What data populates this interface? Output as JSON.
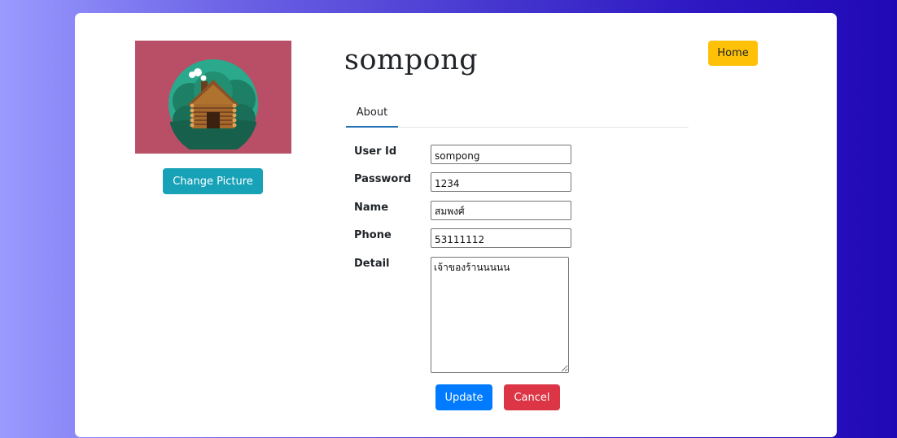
{
  "profile": {
    "username": "sompong",
    "change_picture_label": "Change Picture",
    "avatar_image": "log-cabin-icon"
  },
  "nav": {
    "home_label": "Home"
  },
  "tabs": [
    {
      "label": "About",
      "active": true
    }
  ],
  "form": {
    "fields": [
      {
        "label": "User Id",
        "value": "sompong"
      },
      {
        "label": "Password",
        "value": "1234"
      },
      {
        "label": "Name",
        "value": "สมพงศ์"
      },
      {
        "label": "Phone",
        "value": "53111112"
      },
      {
        "label": "Detail",
        "value": "เจ้าของร้านนนนน"
      }
    ],
    "update_label": "Update",
    "cancel_label": "Cancel"
  },
  "colors": {
    "avatar_bg": "#b94f66",
    "change_button": "#17a2b8",
    "home_button": "#ffc107",
    "update_button": "#007bff",
    "cancel_button": "#dc3545",
    "tab_underline": "#1f6fb2"
  }
}
